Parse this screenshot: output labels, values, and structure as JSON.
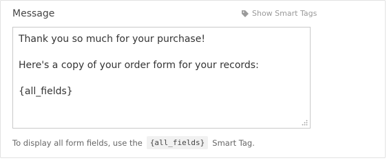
{
  "field": {
    "label": "Message",
    "smart_tags_link": "Show Smart Tags",
    "smart_tags_icon": "tag-icon",
    "textarea_lines": [
      "Thank you so much for your purchase!",
      "",
      "Here's a copy of your order form for your records:",
      "",
      "{all_fields}"
    ]
  },
  "help": {
    "prefix": "To display all form fields, use the",
    "code": "{all_fields}",
    "suffix": "Smart Tag."
  }
}
